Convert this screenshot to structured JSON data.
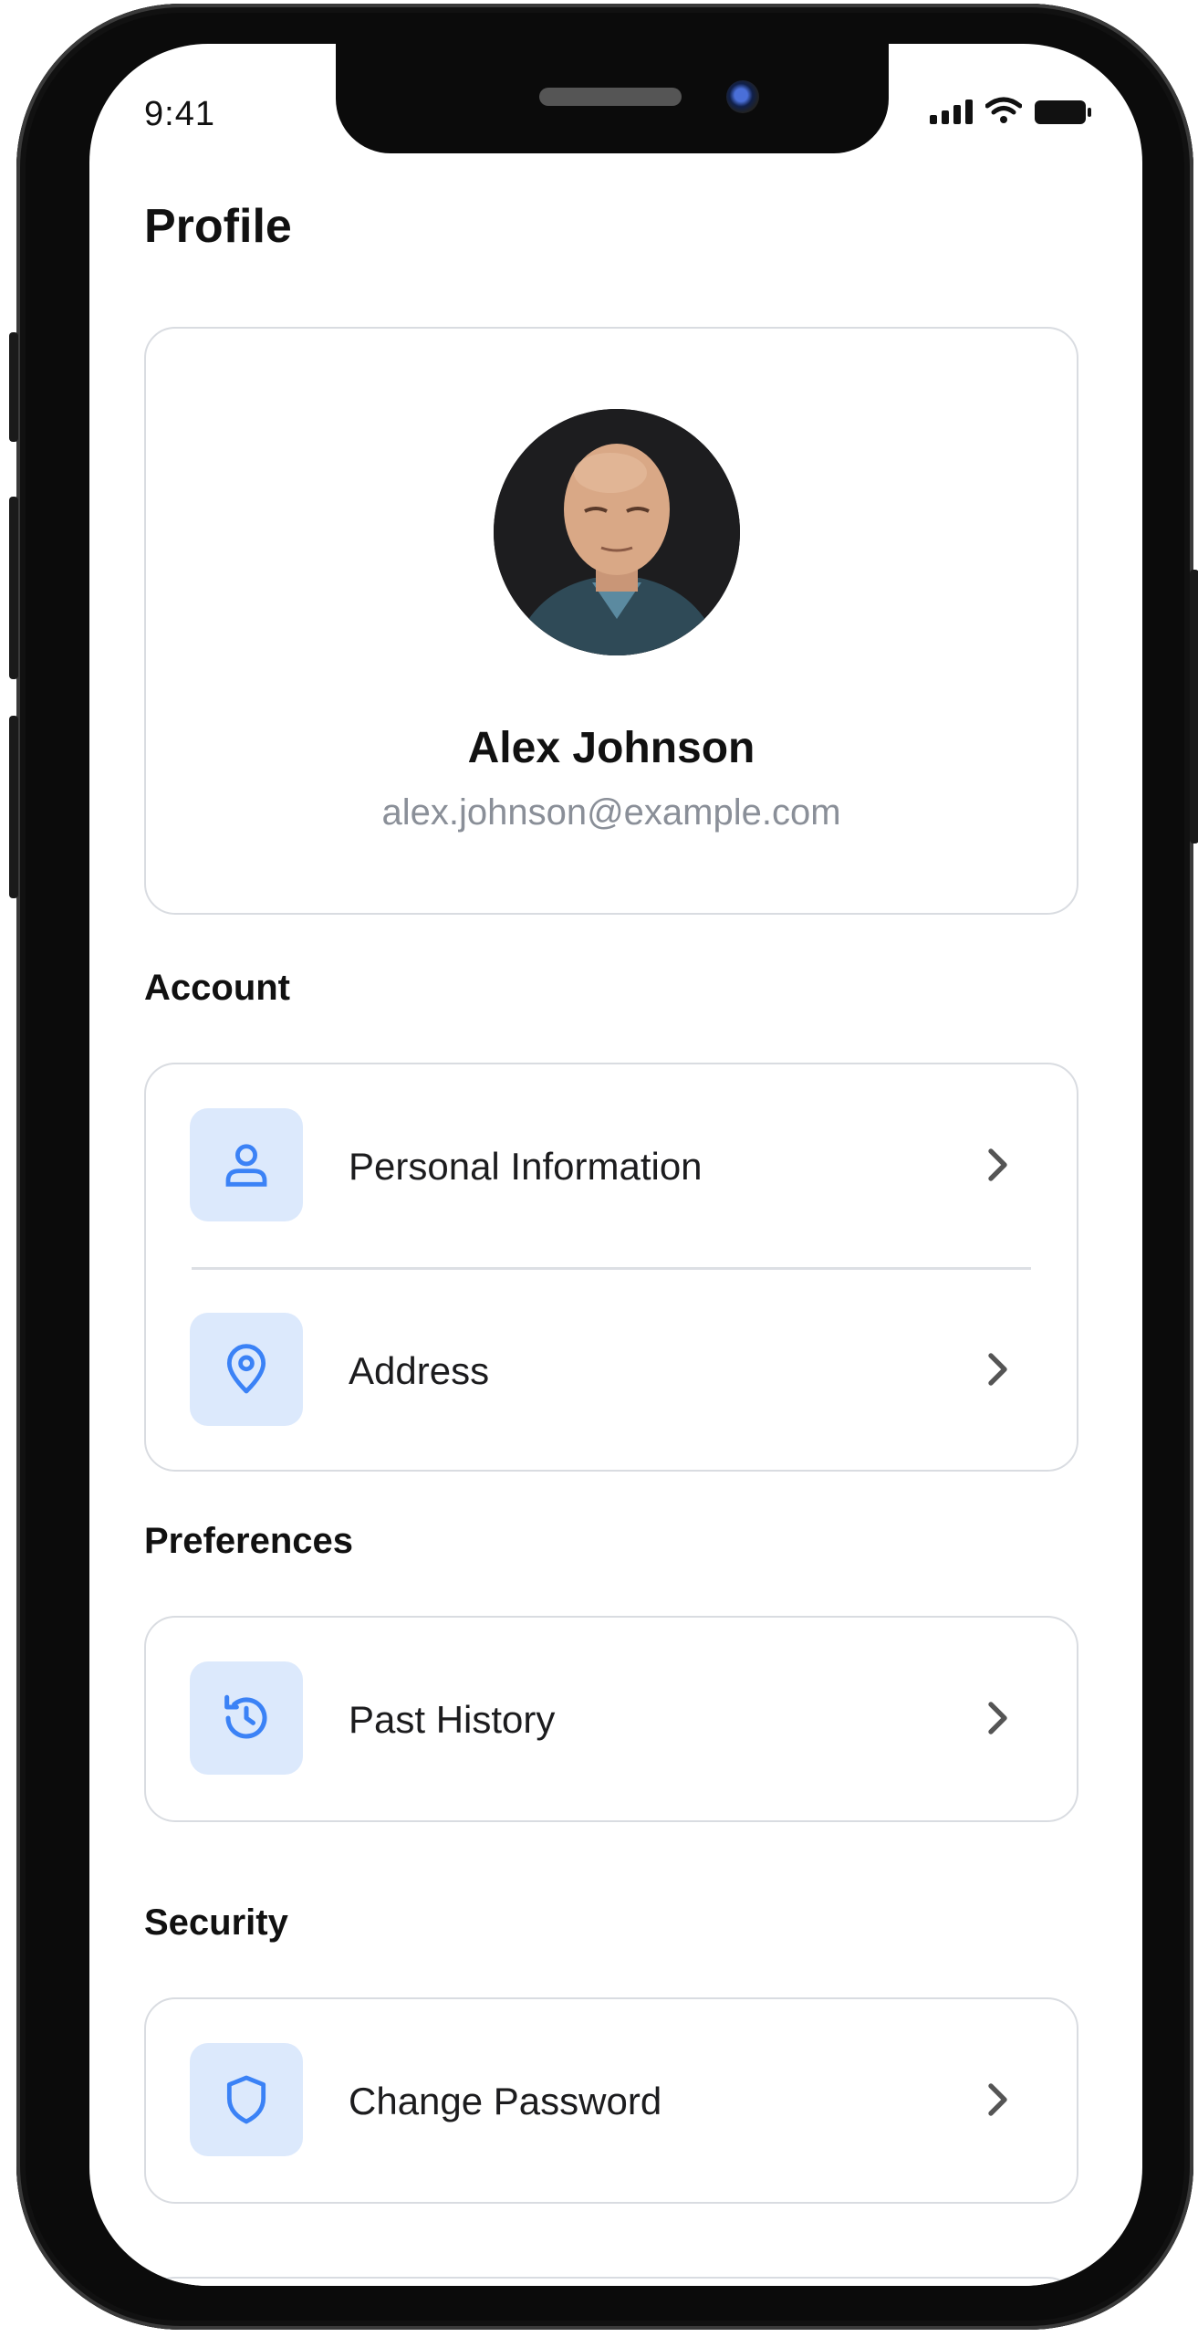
{
  "status_bar": {
    "time": "9:41"
  },
  "header": {
    "title": "Profile"
  },
  "profile": {
    "name": "Alex Johnson",
    "email": "alex.johnson@example.com"
  },
  "sections": {
    "account": {
      "title": "Account",
      "items": [
        {
          "label": "Personal Information",
          "icon": "user-icon"
        },
        {
          "label": "Address",
          "icon": "location-pin-icon"
        }
      ]
    },
    "preferences": {
      "title": "Preferences",
      "items": [
        {
          "label": "Past History",
          "icon": "history-icon"
        }
      ]
    },
    "security": {
      "title": "Security",
      "items": [
        {
          "label": "Change Password",
          "icon": "shield-icon"
        }
      ]
    }
  },
  "colors": {
    "accent": "#3b82f6",
    "icon_bg": "#dce9fc",
    "border": "#d9dce1",
    "muted_text": "#8a8f98"
  }
}
